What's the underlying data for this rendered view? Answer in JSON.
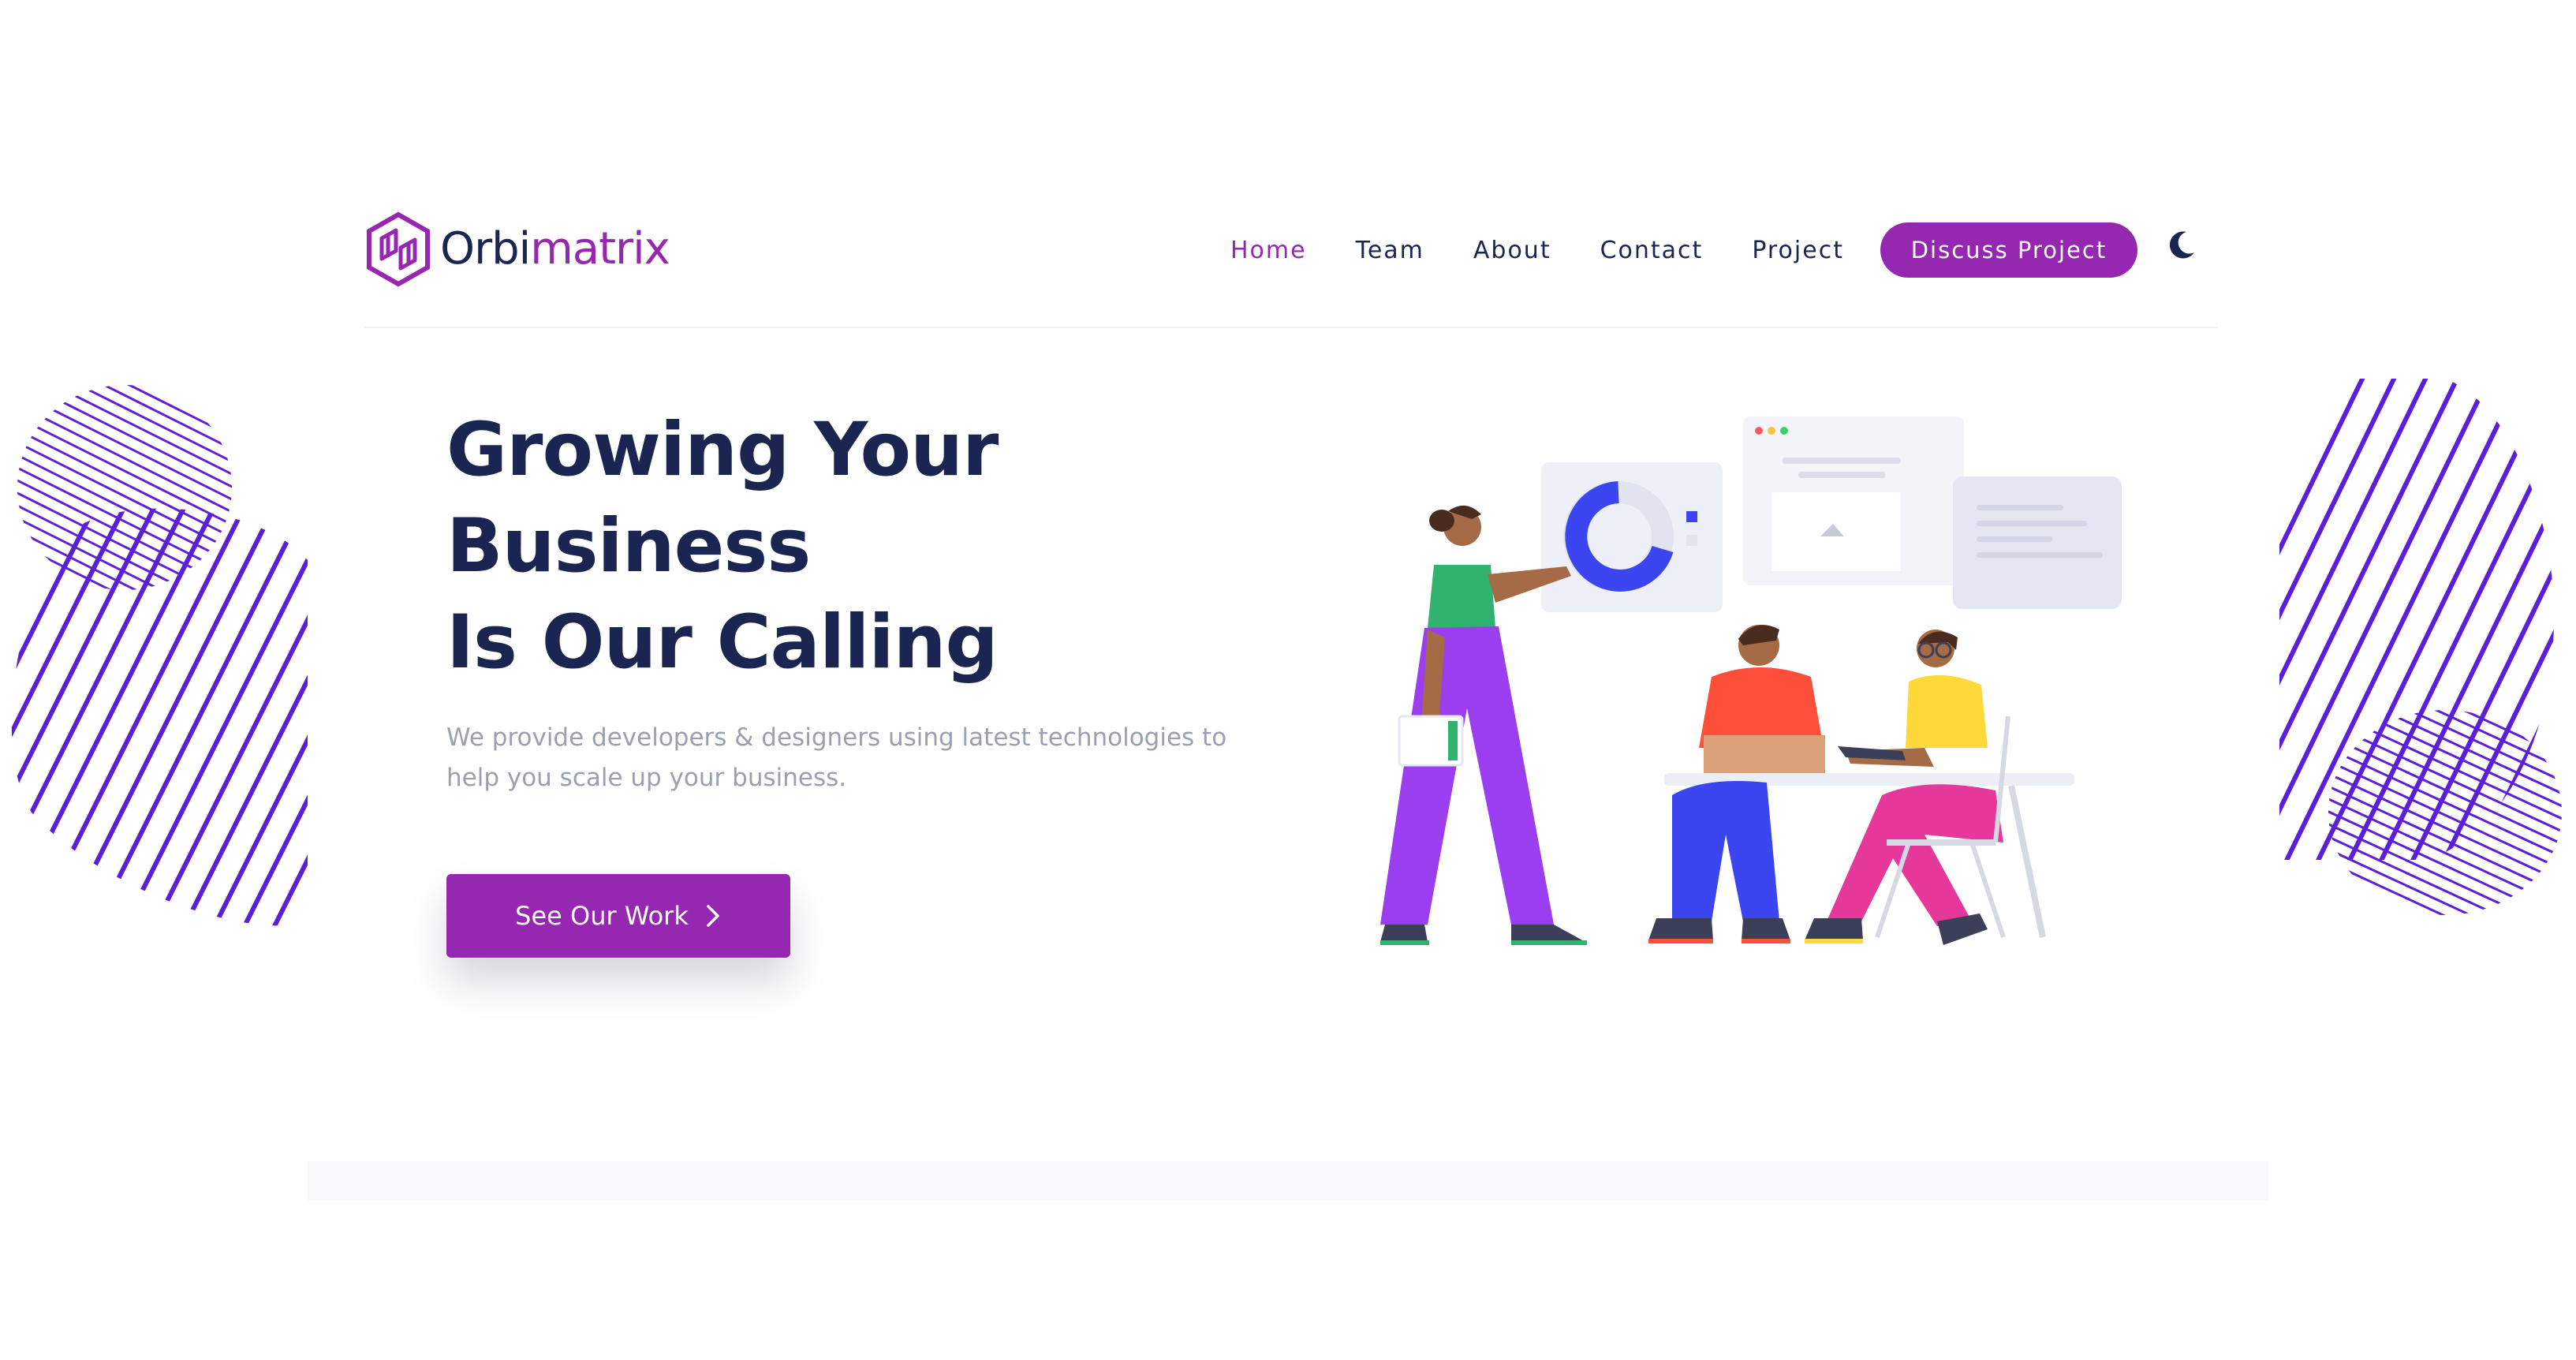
{
  "brand": {
    "name_part1": "Orbi",
    "name_part2": "matrix",
    "primary_color": "#9627b0",
    "dark_color": "#1b2551",
    "accent_stripe_color": "#5b1fd9"
  },
  "nav": {
    "items": [
      {
        "label": "Home",
        "active": true
      },
      {
        "label": "Team",
        "active": false
      },
      {
        "label": "About",
        "active": false
      },
      {
        "label": "Contact",
        "active": false
      },
      {
        "label": "Project",
        "active": false
      }
    ],
    "cta_label": "Discuss Project",
    "theme_toggle_icon": "moon-icon"
  },
  "hero": {
    "title_lines": [
      "Growing Your",
      "Business",
      "Is Our Calling"
    ],
    "subtitle": "We provide developers & designers using latest technologies to help you scale up your business.",
    "button_label": "See Our Work",
    "button_icon": "chevron-right-icon"
  }
}
